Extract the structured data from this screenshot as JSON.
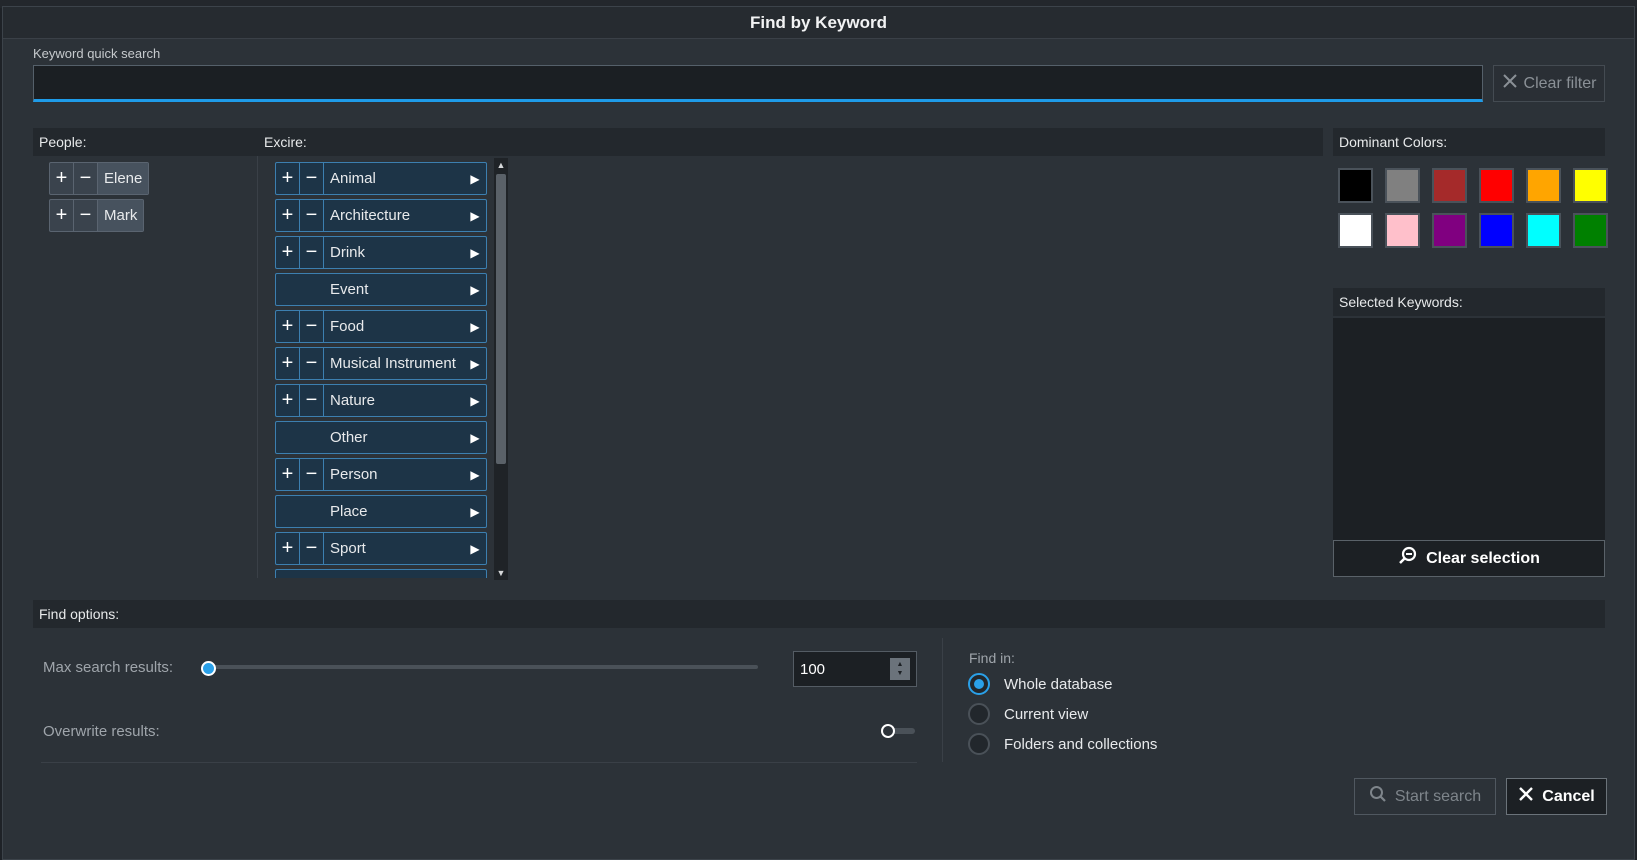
{
  "dialog": {
    "title": "Find by Keyword"
  },
  "quick_search": {
    "label": "Keyword quick search",
    "value": "",
    "placeholder": "",
    "clear_filter_label": "Clear filter"
  },
  "people": {
    "header": "People:",
    "items": [
      {
        "name": "Elene"
      },
      {
        "name": "Mark"
      }
    ]
  },
  "excire": {
    "header": "Excire:",
    "items": [
      {
        "label": "Animal",
        "has_plus_minus": true
      },
      {
        "label": "Architecture",
        "has_plus_minus": true
      },
      {
        "label": "Drink",
        "has_plus_minus": true
      },
      {
        "label": "Event",
        "has_plus_minus": false
      },
      {
        "label": "Food",
        "has_plus_minus": true
      },
      {
        "label": "Musical Instrument",
        "has_plus_minus": true
      },
      {
        "label": "Nature",
        "has_plus_minus": true
      },
      {
        "label": "Other",
        "has_plus_minus": false
      },
      {
        "label": "Person",
        "has_plus_minus": true
      },
      {
        "label": "Place",
        "has_plus_minus": false
      },
      {
        "label": "Sport",
        "has_plus_minus": true
      }
    ]
  },
  "dominant_colors": {
    "header": "Dominant Colors:",
    "swatches": [
      "#000000",
      "#808080",
      "#a52a2a",
      "#ff0000",
      "#ffa500",
      "#ffff00",
      "#ffffff",
      "#ffc0cb",
      "#800080",
      "#0000ff",
      "#00ffff",
      "#008000"
    ]
  },
  "selected_keywords": {
    "header": "Selected Keywords:",
    "clear_selection_label": "Clear selection"
  },
  "find_options": {
    "header": "Find options:",
    "max_results_label": "Max search results:",
    "max_results_value": "100",
    "max_results_slider_fraction": 0.0,
    "overwrite_label": "Overwrite results:",
    "overwrite_on": false,
    "find_in_label": "Find in:",
    "find_in_options": [
      {
        "label": "Whole database",
        "selected": true
      },
      {
        "label": "Current view",
        "selected": false
      },
      {
        "label": "Folders and collections",
        "selected": false
      }
    ]
  },
  "buttons": {
    "start_search": "Start search",
    "cancel": "Cancel"
  },
  "colors": {
    "accent": "#2aa0e8",
    "keyword_chip": "#1d3447"
  }
}
